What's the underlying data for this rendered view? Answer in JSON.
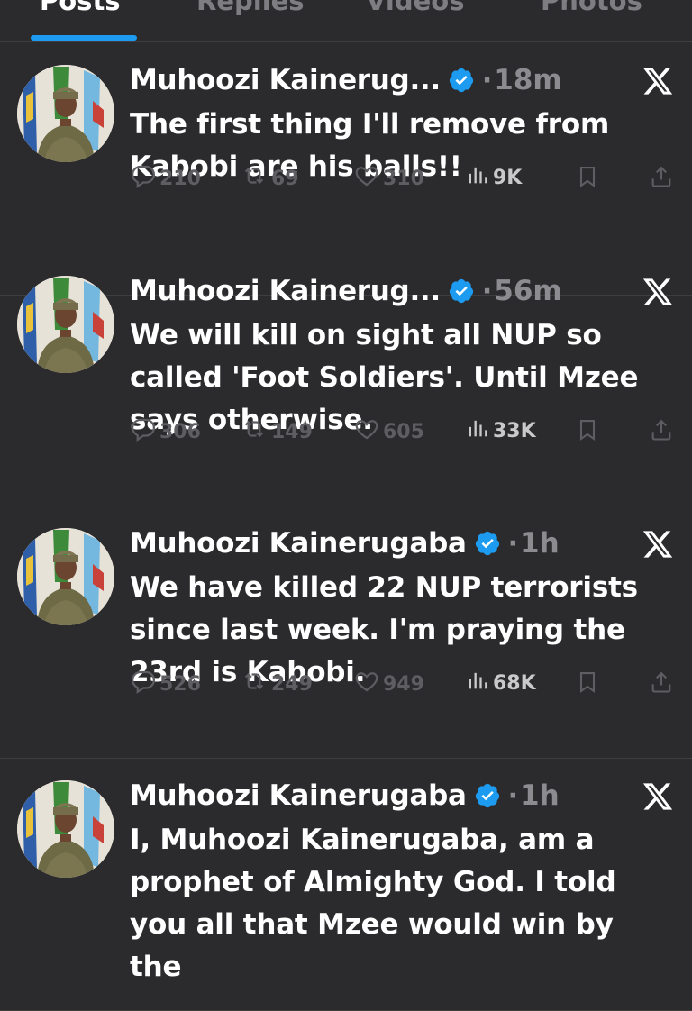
{
  "tabs": [
    {
      "label": "Posts",
      "active": true
    },
    {
      "label": "Replies",
      "active": false
    },
    {
      "label": "Videos",
      "active": false
    },
    {
      "label": "Photos",
      "active": false
    }
  ],
  "posts": [
    {
      "author": "Muhoozi Kainerug...",
      "time": "18m",
      "text": "The first thing I'll remove from Kabobi are his balls!!",
      "replies": "210",
      "reposts": "69",
      "likes": "310",
      "views": "9K"
    },
    {
      "author": "Muhoozi Kainerug...",
      "time": "56m",
      "text": "We will kill on sight all NUP so called 'Foot Soldiers'. Until Mzee says otherwise.",
      "replies": "306",
      "reposts": "149",
      "likes": "605",
      "views": "33K"
    },
    {
      "author": "Muhoozi Kainerugaba",
      "time": "1h",
      "text": "We have killed 22 NUP terrorists since last week. I'm praying the 23rd is Kabobi.",
      "replies": "526",
      "reposts": "249",
      "likes": "949",
      "views": "68K"
    },
    {
      "author": "Muhoozi Kainerugaba",
      "time": "1h",
      "text": "I, Muhoozi Kainerugaba, am a prophet of Almighty God. I told you all that Mzee would win by the",
      "replies": "",
      "reposts": "",
      "likes": "",
      "views": ""
    }
  ],
  "icons": {
    "verified": "verified-badge-icon",
    "platform": "x-logo-icon",
    "reply": "reply-bubble-icon",
    "repost": "repost-icon",
    "like": "heart-icon",
    "views": "views-bar-icon",
    "bookmark": "bookmark-icon",
    "share": "share-icon"
  },
  "colors": {
    "background": "#2b2b2d",
    "accent": "#1d9bf0",
    "text": "#ffffff",
    "muted": "#8b8b90"
  }
}
